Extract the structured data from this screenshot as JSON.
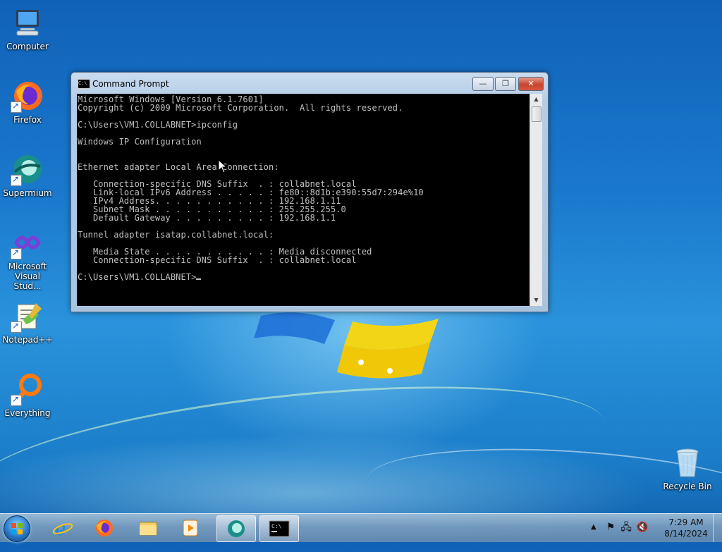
{
  "desktop": {
    "icons": [
      {
        "label": "Computer"
      },
      {
        "label": "Firefox"
      },
      {
        "label": "Supermium"
      },
      {
        "label": "Microsoft Visual Stud..."
      },
      {
        "label": "Notepad++"
      },
      {
        "label": "Everything"
      },
      {
        "label": "Recycle Bin"
      }
    ]
  },
  "cmd": {
    "title": "Command Prompt",
    "minimize_label": "—",
    "maximize_label": "❐",
    "close_label": "✕",
    "lines": [
      "Microsoft Windows [Version 6.1.7601]",
      "Copyright (c) 2009 Microsoft Corporation.  All rights reserved.",
      "",
      "C:\\Users\\VM1.COLLABNET>ipconfig",
      "",
      "Windows IP Configuration",
      "",
      "",
      "Ethernet adapter Local Area Connection:",
      "",
      "   Connection-specific DNS Suffix  . : collabnet.local",
      "   Link-local IPv6 Address . . . . . : fe80::8d1b:e390:55d7:294e%10",
      "   IPv4 Address. . . . . . . . . . . : 192.168.1.11",
      "   Subnet Mask . . . . . . . . . . . : 255.255.255.0",
      "   Default Gateway . . . . . . . . . : 192.168.1.1",
      "",
      "Tunnel adapter isatap.collabnet.local:",
      "",
      "   Media State . . . . . . . . . . . : Media disconnected",
      "   Connection-specific DNS Suffix  . : collabnet.local",
      "",
      "C:\\Users\\VM1.COLLABNET>"
    ]
  },
  "taskbar": {
    "clock_time": "7:29 AM",
    "clock_date": "8/14/2024",
    "tray_arrow": "▲"
  }
}
